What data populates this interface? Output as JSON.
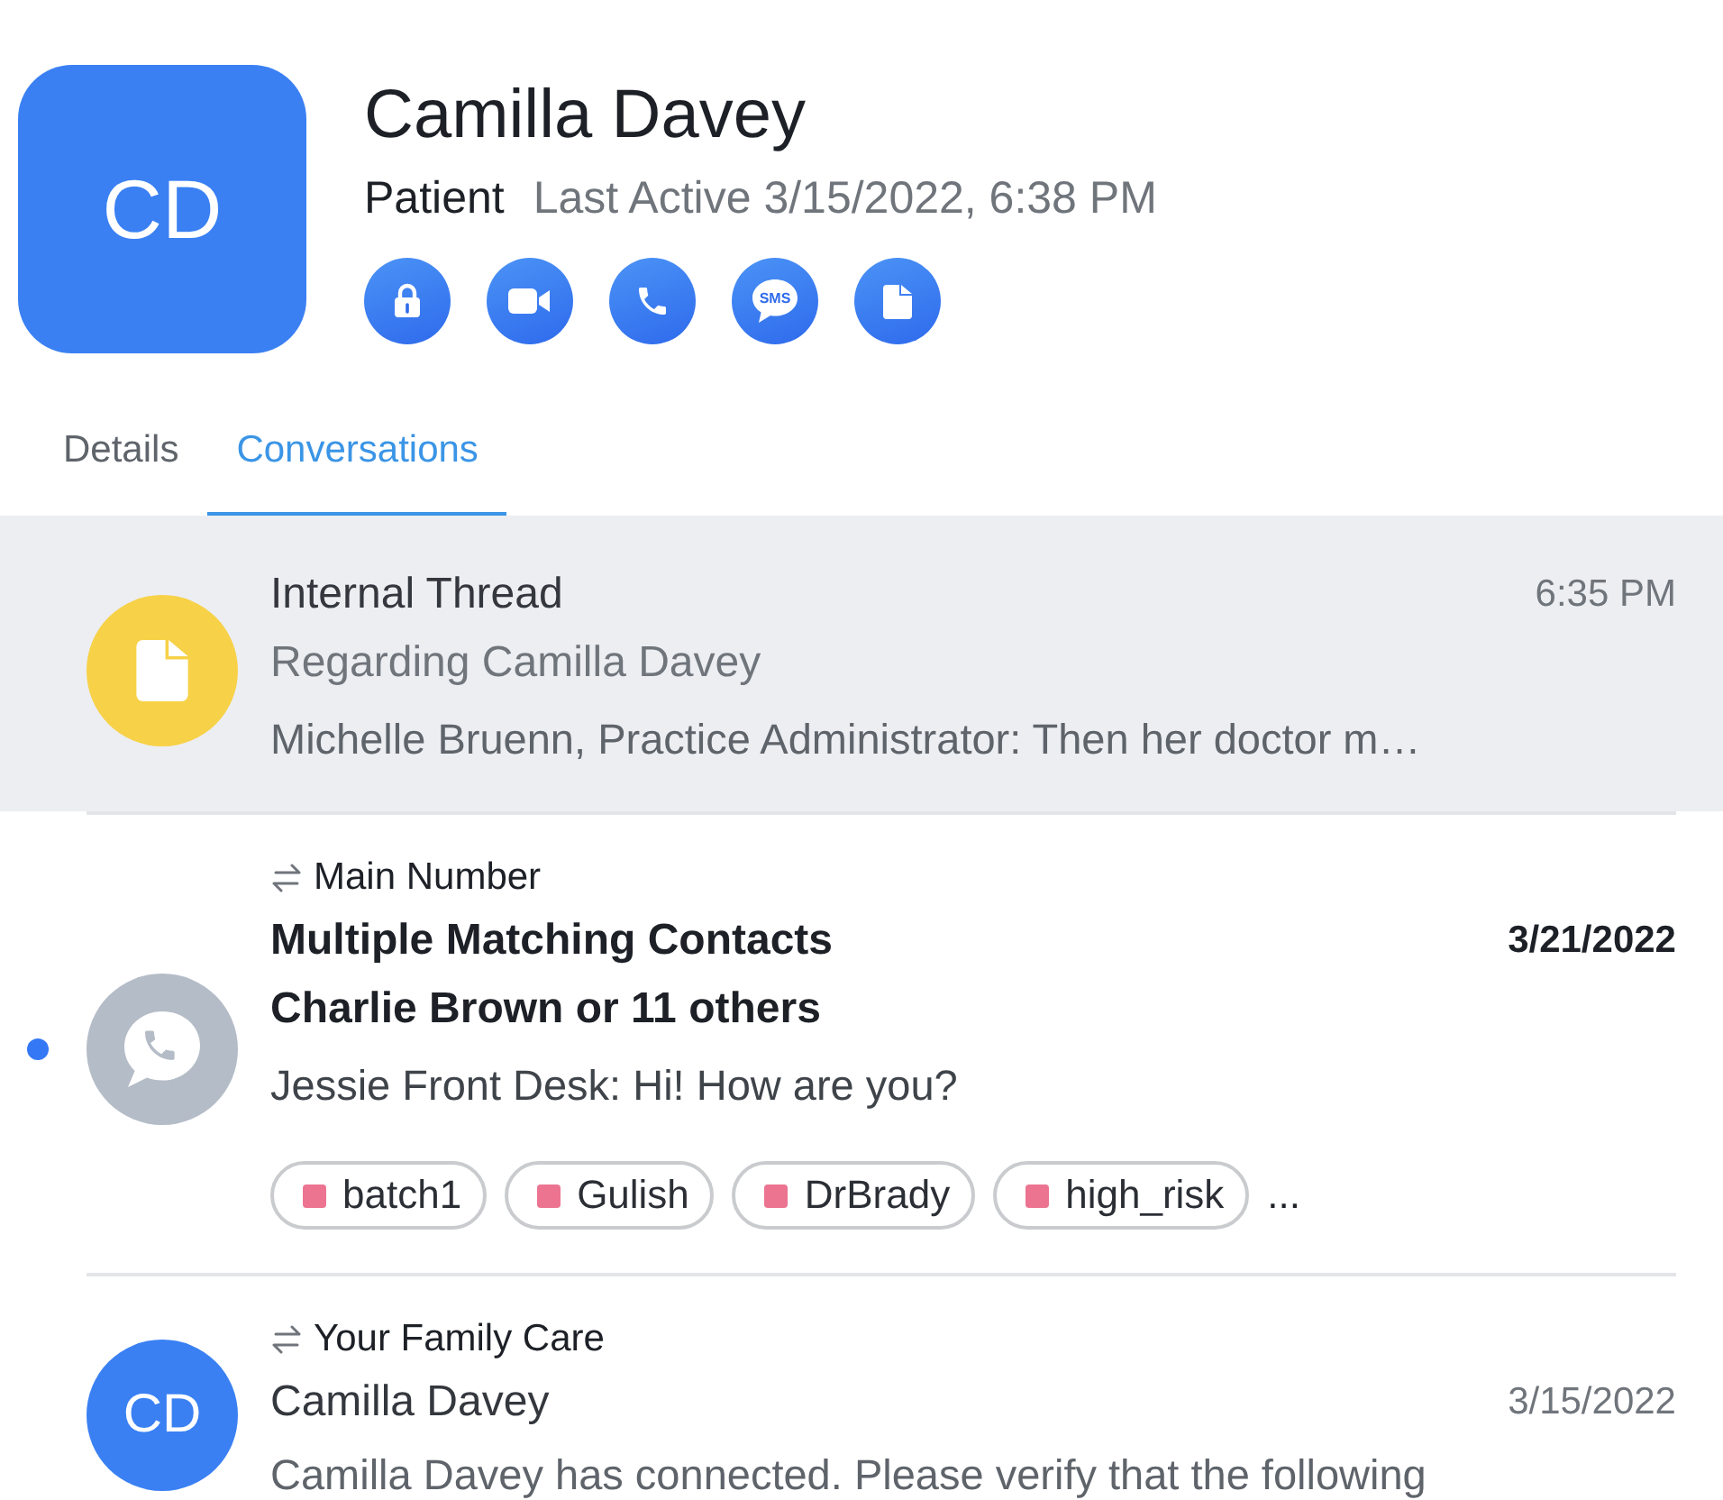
{
  "contact": {
    "initials": "CD",
    "name": "Camilla Davey",
    "role": "Patient",
    "last_active": "Last Active 3/15/2022, 6:38 PM",
    "actions": [
      {
        "kind": "lock"
      },
      {
        "kind": "video"
      },
      {
        "kind": "phone"
      },
      {
        "kind": "sms",
        "label": "SMS"
      },
      {
        "kind": "note"
      }
    ]
  },
  "tabs": [
    {
      "label": "Details",
      "selected": false
    },
    {
      "label": "Conversations",
      "selected": true
    }
  ],
  "conversations": [
    {
      "kind": "internal",
      "selected": true,
      "unread": false,
      "title": "Internal Thread",
      "time": "6:35 PM",
      "subtitle": "Regarding Camilla Davey",
      "preview": "Michelle Bruenn, Practice Administrator: Then her doctor m…"
    },
    {
      "kind": "whatsapp",
      "selected": false,
      "unread": true,
      "channel": "Main Number",
      "title": "Multiple Matching Contacts",
      "time": "3/21/2022",
      "subtitle": "Charlie Brown or 11 others",
      "preview": "Jessie Front Desk: Hi! How are you?",
      "tags": [
        {
          "label": "batch1",
          "color": "#ec7491"
        },
        {
          "label": "Gulish",
          "color": "#ec7491"
        },
        {
          "label": "DrBrady",
          "color": "#ec7491"
        },
        {
          "label": "high_risk",
          "color": "#ec7491"
        }
      ],
      "more": "..."
    },
    {
      "kind": "initials",
      "selected": false,
      "unread": false,
      "channel": "Your Family Care",
      "initials": "CD",
      "title": "Camilla Davey",
      "time": "3/15/2022",
      "preview": "Camilla Davey has connected. Please verify that the following"
    }
  ]
}
